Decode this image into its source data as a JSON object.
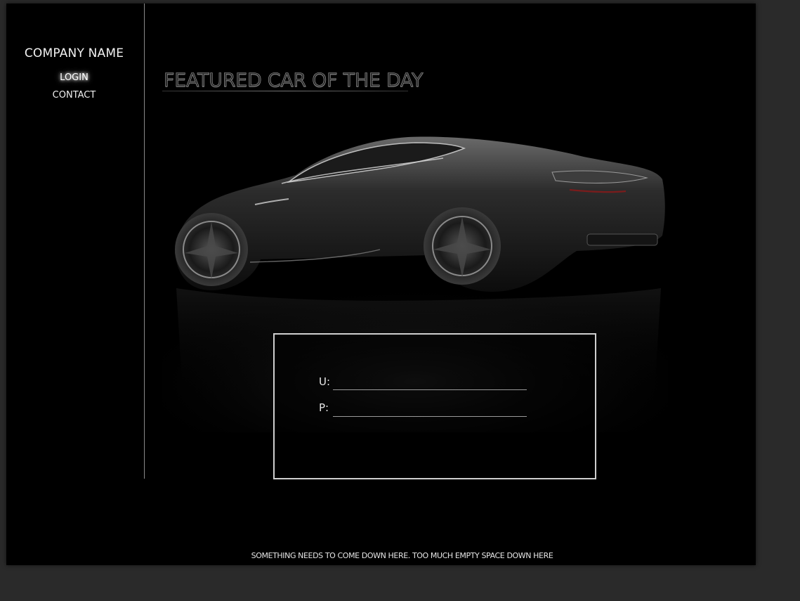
{
  "sidebar": {
    "company_name": "COMPANY NAME",
    "nav": {
      "login": "LOGIN",
      "contact": "CONTACT"
    }
  },
  "main": {
    "title": "FEATURED CAR OF THE DAY",
    "featured_image": "dark-sports-car"
  },
  "login_form": {
    "username_label": "U:",
    "password_label": "P:",
    "username_value": "",
    "password_value": ""
  },
  "footer": {
    "text": "SOMETHING NEEDS TO COME DOWN HERE. TOO MUCH EMPTY SPACE DOWN HERE"
  }
}
